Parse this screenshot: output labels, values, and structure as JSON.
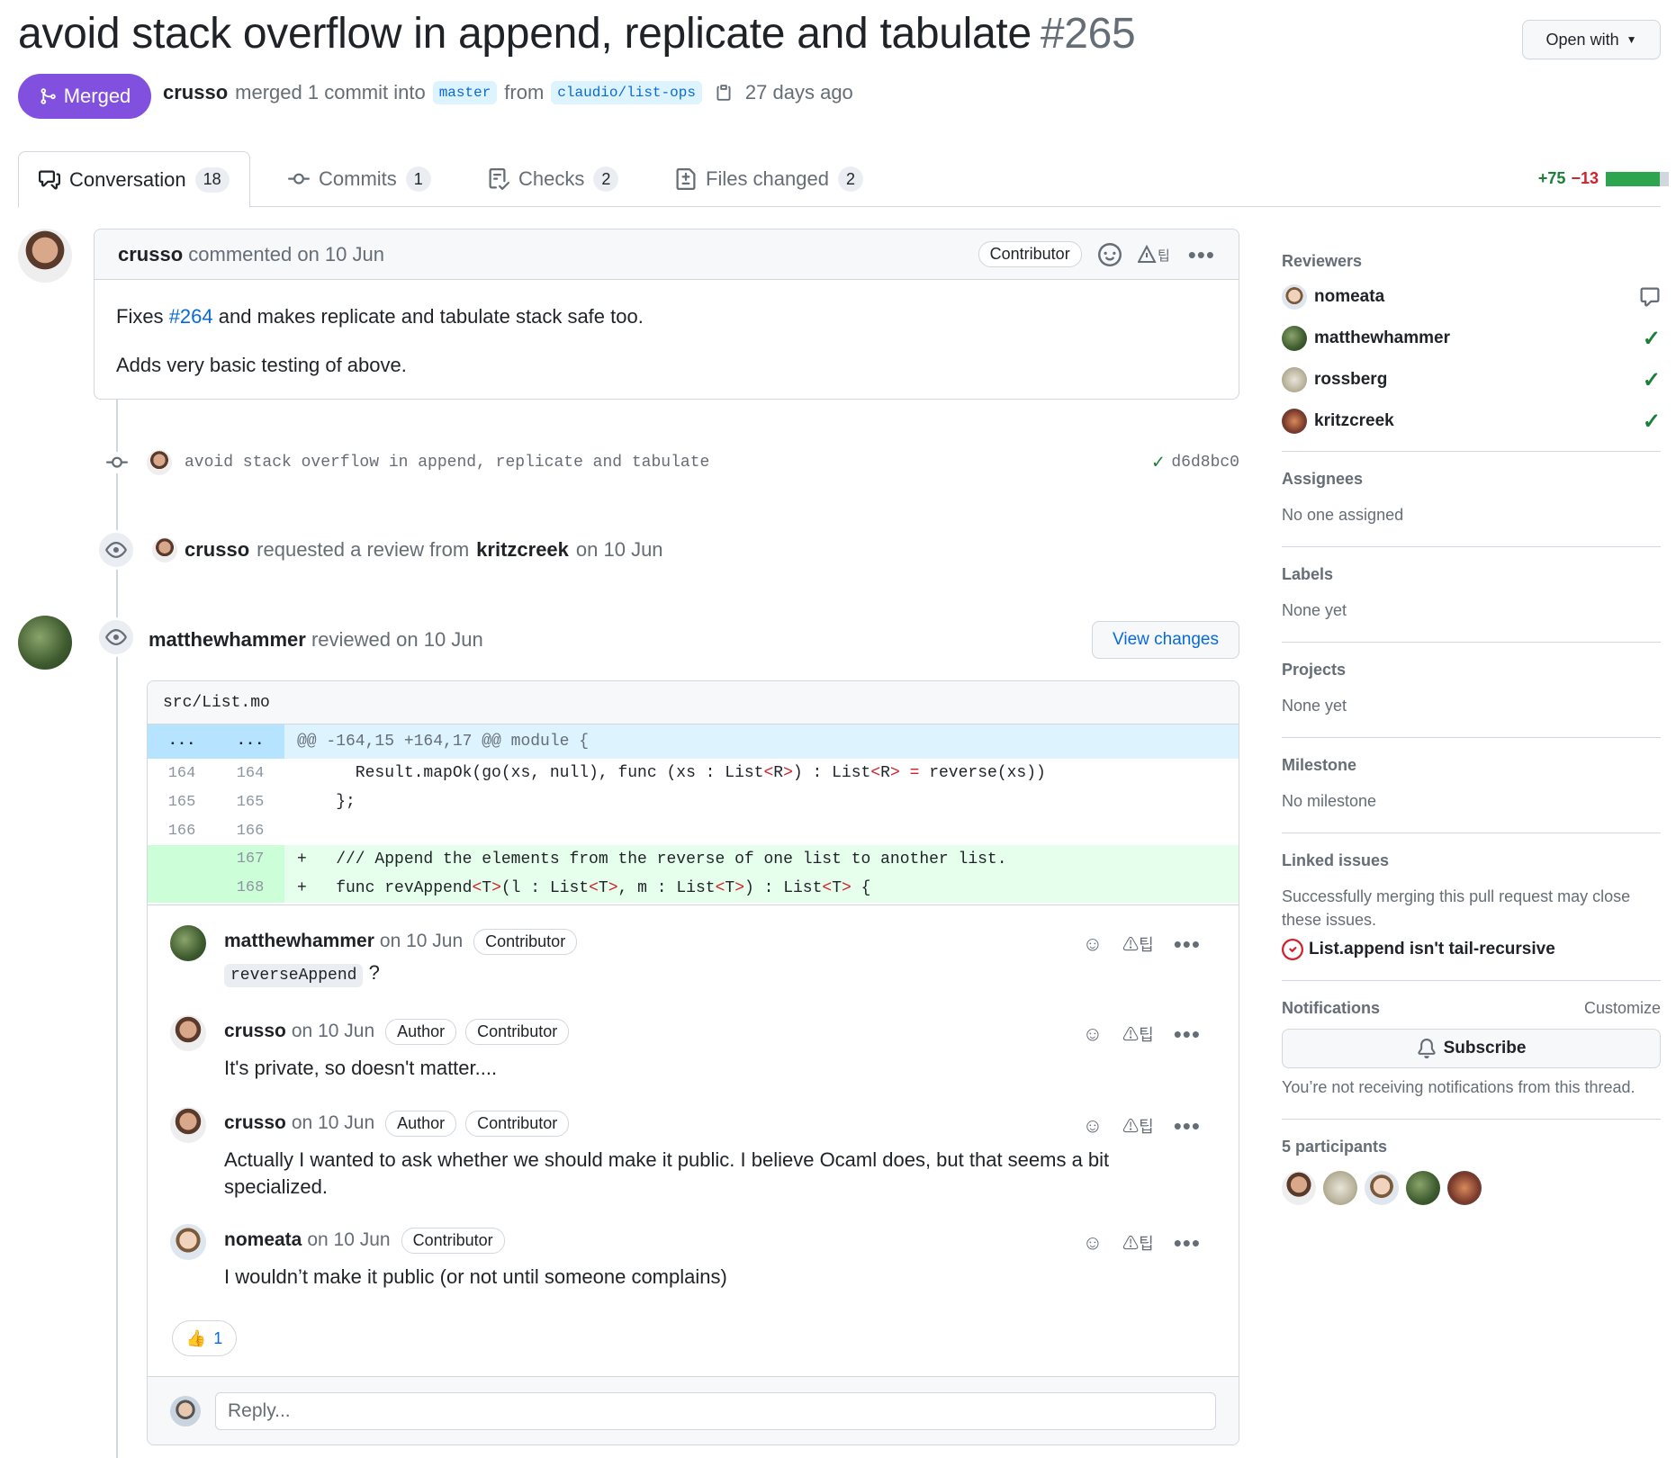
{
  "header": {
    "title": "avoid stack overflow in append, replicate and tabulate",
    "number": "#265",
    "open_with": "Open with",
    "state": "Merged",
    "merger": "crusso",
    "merge_text": "merged 1 commit into",
    "base_branch": "master",
    "from_text": "from",
    "head_branch": "claudio/list-ops",
    "time": "27 days ago"
  },
  "tabs": [
    {
      "label": "Conversation",
      "count": "18"
    },
    {
      "label": "Commits",
      "count": "1"
    },
    {
      "label": "Checks",
      "count": "2"
    },
    {
      "label": "Files changed",
      "count": "2"
    }
  ],
  "diffstat": {
    "additions": "+75",
    "deletions": "−13",
    "add_fraction": 0.85
  },
  "first_comment": {
    "author": "crusso",
    "meta": "commented on 10 Jun",
    "badge": "Contributor",
    "line1_pre": "Fixes",
    "line1_link": "#264",
    "line1_post": "and makes replicate and tabulate stack safe too.",
    "line2": "Adds very basic testing of above."
  },
  "commit": {
    "message": "avoid stack overflow in append, replicate and tabulate",
    "sha": "d6d8bc0"
  },
  "review_request": {
    "actor": "crusso",
    "text": "requested a review from",
    "reviewer": "kritzcreek",
    "date": "on 10 Jun"
  },
  "review": {
    "author": "matthewhammer",
    "meta": "reviewed on 10 Jun",
    "view_changes": "View changes",
    "file": "src/List.mo",
    "hunk": "@@ -164,15 +164,17 @@ module {",
    "hunk_dots": "...",
    "lines": [
      {
        "old": "164",
        "new": "164",
        "sign": " ",
        "code": "    Result.mapOk(go(xs, null), func (xs : List<R>) : List<R> = reverse(xs))"
      },
      {
        "old": "165",
        "new": "165",
        "sign": " ",
        "code": "  };"
      },
      {
        "old": "166",
        "new": "166",
        "sign": " ",
        "code": ""
      },
      {
        "old": "",
        "new": "167",
        "sign": "+",
        "code": "  /// Append the elements from the reverse of one list to another list."
      },
      {
        "old": "",
        "new": "168",
        "sign": "+",
        "code": "  func revAppend<T>(l : List<T>, m : List<T>) : List<T> {"
      }
    ],
    "comments": [
      {
        "author": "matthewhammer",
        "date": "on 10 Jun",
        "badges": [
          "Contributor"
        ],
        "code": "reverseAppend",
        "text": "?"
      },
      {
        "author": "crusso",
        "date": "on 10 Jun",
        "badges": [
          "Author",
          "Contributor"
        ],
        "text": "It's private, so doesn't matter...."
      },
      {
        "author": "crusso",
        "date": "on 10 Jun",
        "badges": [
          "Author",
          "Contributor"
        ],
        "text": "Actually I wanted to ask whether we should make it public. I believe Ocaml does, but that seems a bit specialized."
      },
      {
        "author": "nomeata",
        "date": "on 10 Jun",
        "badges": [
          "Contributor"
        ],
        "text": "I wouldn’t make it public (or not until someone complains)"
      }
    ],
    "reaction": {
      "emoji": "👍",
      "count": "1"
    },
    "reply_placeholder": "Reply..."
  },
  "sidebar": {
    "reviewers_title": "Reviewers",
    "reviewers": [
      {
        "name": "nomeata",
        "status": "commented"
      },
      {
        "name": "matthewhammer",
        "status": "approved"
      },
      {
        "name": "rossberg",
        "status": "approved"
      },
      {
        "name": "kritzcreek",
        "status": "approved"
      }
    ],
    "assignees_title": "Assignees",
    "assignees_text": "No one assigned",
    "labels_title": "Labels",
    "labels_text": "None yet",
    "projects_title": "Projects",
    "projects_text": "None yet",
    "milestone_title": "Milestone",
    "milestone_text": "No milestone",
    "linked_title": "Linked issues",
    "linked_text": "Successfully merging this pull request may close these issues.",
    "linked_issue": "List.append isn't tail-recursive",
    "notifications_title": "Notifications",
    "customize": "Customize",
    "subscribe": "Subscribe",
    "notif_text": "You’re not receiving notifications from this thread.",
    "participants_title": "5 participants"
  },
  "colors": {
    "merged": "#8250df",
    "link": "#0969da",
    "add": "#1a7f37",
    "del": "#cf222e"
  }
}
